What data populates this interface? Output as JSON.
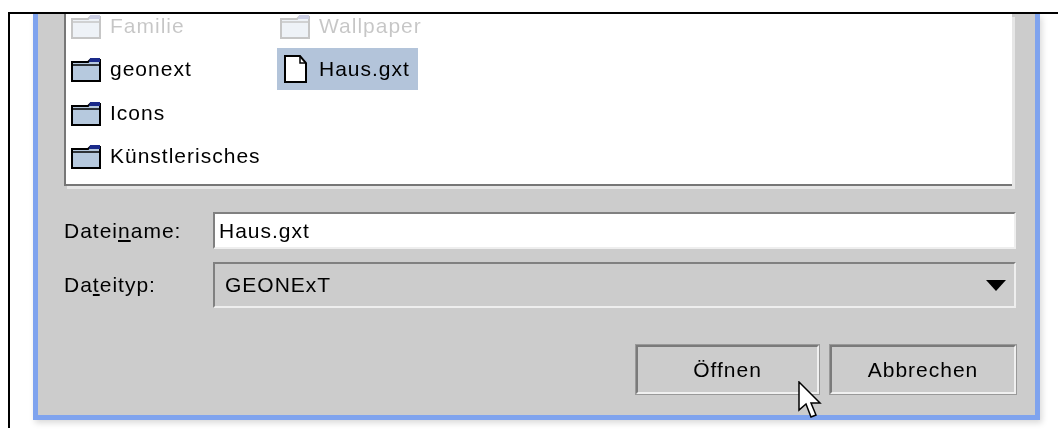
{
  "file_list": {
    "items": [
      {
        "name": "Familie",
        "kind": "folder",
        "selected": false,
        "faded": true
      },
      {
        "name": "geonext",
        "kind": "folder",
        "selected": false,
        "faded": false
      },
      {
        "name": "Icons",
        "kind": "folder",
        "selected": false,
        "faded": false
      },
      {
        "name": "Künstlerisches",
        "kind": "folder",
        "selected": false,
        "faded": false
      },
      {
        "name": "Wallpaper",
        "kind": "folder",
        "selected": false,
        "faded": true
      },
      {
        "name": "Haus.gxt",
        "kind": "file",
        "selected": true,
        "faded": false
      }
    ]
  },
  "file_name": {
    "label_before": "Datei",
    "mnemonic": "n",
    "label_after": "ame:",
    "value": "Haus.gxt"
  },
  "file_type": {
    "label_before": "Da",
    "mnemonic": "t",
    "label_after": "eityp:",
    "value": "GEONExT"
  },
  "buttons": [
    "Öffnen",
    "Abbrechen"
  ]
}
